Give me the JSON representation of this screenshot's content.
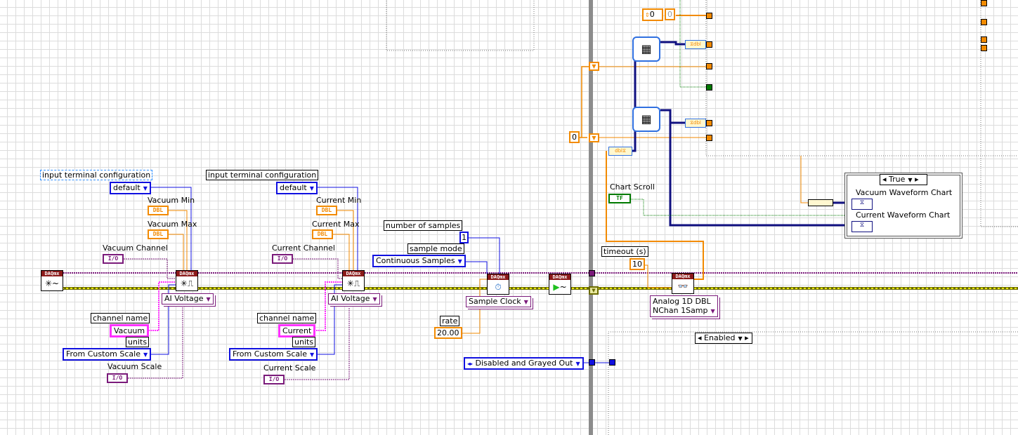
{
  "diagram": {
    "daqmx_label": "DAQmx",
    "channel1": {
      "terminal_config_label": "input terminal configuration",
      "terminal_config_value": "default",
      "min_label": "Vacuum Min",
      "max_label": "Vacuum Max",
      "channel_label": "Vacuum Channel",
      "type_value": "AI Voltage",
      "channel_name_label": "channel name",
      "channel_name_value": "Vacuum",
      "units_label": "units",
      "units_value": "From Custom Scale",
      "scale_label": "Vacuum Scale"
    },
    "channel2": {
      "terminal_config_label": "input terminal configuration",
      "terminal_config_value": "default",
      "min_label": "Current Min",
      "max_label": "Current Max",
      "channel_label": "Current Channel",
      "type_value": "AI Voltage",
      "channel_name_label": "channel name",
      "channel_name_value": "Current",
      "units_label": "units",
      "units_value": "From Custom Scale",
      "scale_label": "Current Scale"
    },
    "dbl_tag": "DBL",
    "io_tag": "I/O",
    "timing": {
      "samples_label": "number of samples",
      "samples_value": "1",
      "mode_label": "sample mode",
      "mode_value": "Continuous Samples",
      "clock_value": "Sample Clock",
      "rate_label": "rate",
      "rate_value": "20.00"
    },
    "read": {
      "timeout_label": "timeout (s)",
      "timeout_value": "10",
      "mode_value_line1": "Analog 1D DBL",
      "mode_value_line2": "NChan 1Samp"
    },
    "loop": {
      "init_constant": "0",
      "counter_control": "0",
      "counter_indicator": "0",
      "chart_scroll_label": "Chart Scroll",
      "chart_scroll_tag": "TF",
      "case_selector": "True",
      "vacuum_chart_label": "Vacuum Waveform Chart",
      "current_chart_label": "Current Waveform Chart",
      "enabled_selector": "Enabled",
      "disabled_state_value": "Disabled and Grayed Out"
    },
    "colors": {
      "numeric_wire": "#f28a00",
      "enum_wire": "#1010e0",
      "task_wire": "#7a1a7a",
      "string_wire": "#ff30ff",
      "boolean_wire": "#007a00",
      "waveform_wire": "#101080",
      "loop_border": "#8c8c8c"
    }
  }
}
